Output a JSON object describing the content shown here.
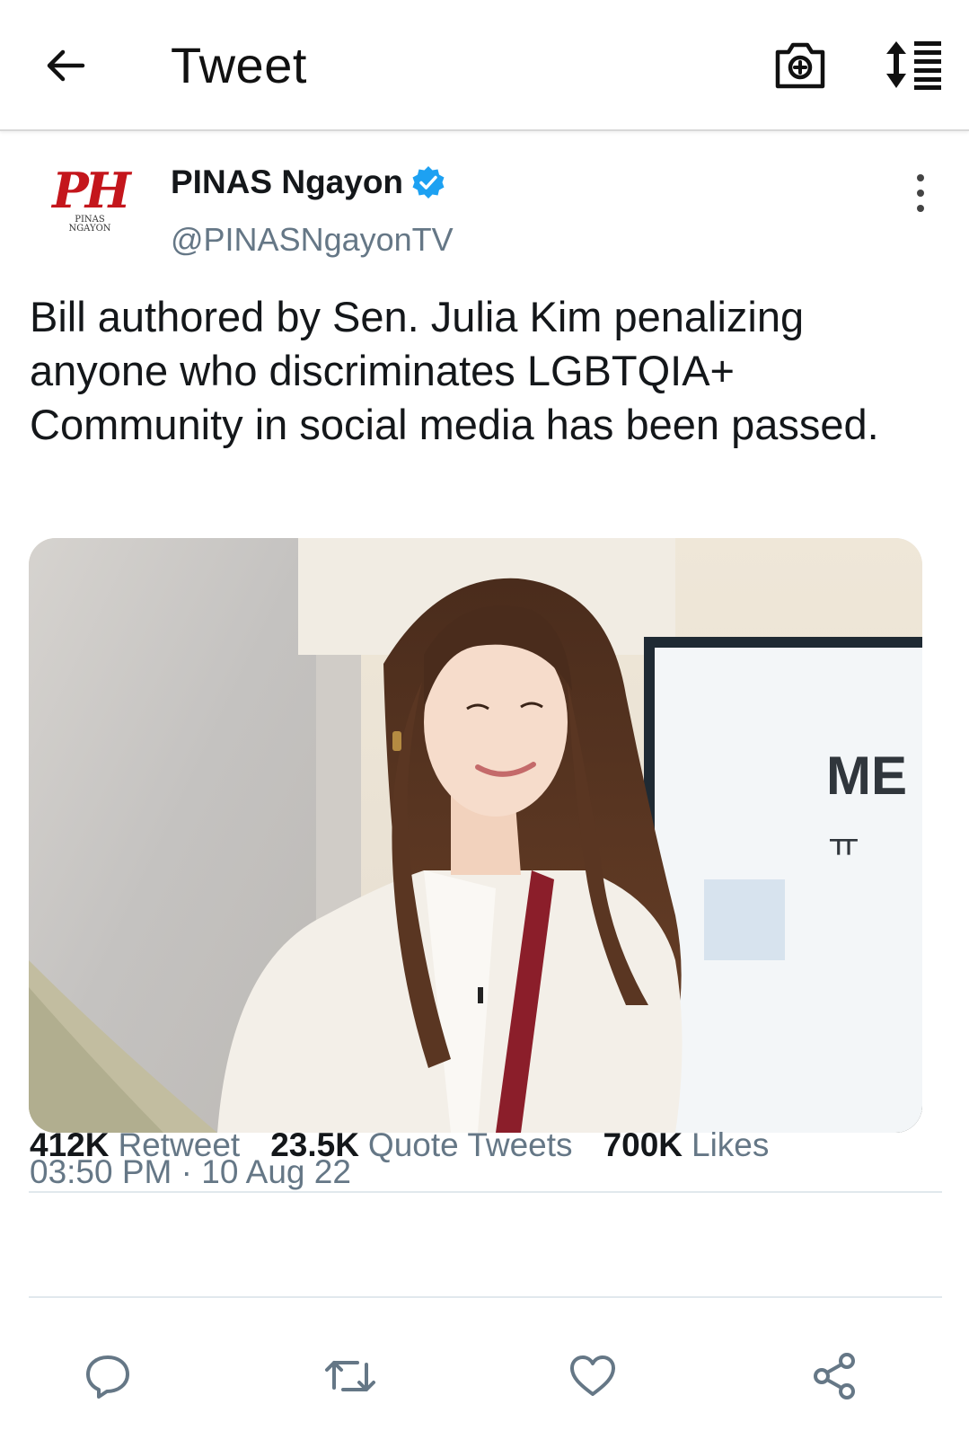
{
  "header": {
    "title": "Tweet",
    "back_icon": "arrow-left-icon",
    "camera_icon": "camera-plus-icon",
    "sort_icon": "sort-list-icon"
  },
  "tweet": {
    "display_name": "PINAS Ngayon",
    "verified": true,
    "handle": "@PINASNgayonTV",
    "avatar": {
      "mark": "PH",
      "sub_line1": "PINAS",
      "sub_line2": "NGAYON"
    },
    "text": "Bill authored by Sen. Julia Kim penalizing anyone who discriminates LGBTQIA+ Community in social media has been passed.",
    "media": {
      "screen_text_line1": "ME",
      "screen_text_line2": "ㅠ"
    },
    "timestamp": "03:50 PM · 10 Aug 22",
    "stats": {
      "retweets_count": "412K",
      "retweets_label": "Retweet",
      "quotes_count": "23.5K",
      "quotes_label": "Quote Tweets",
      "likes_count": "700K",
      "likes_label": "Likes"
    }
  },
  "actions": {
    "reply_icon": "reply-bubble-icon",
    "retweet_icon": "retweet-icon",
    "like_icon": "heart-icon",
    "share_icon": "share-icon"
  },
  "colors": {
    "verified_blue": "#1da1f2",
    "secondary_text": "#657786",
    "avatar_red": "#c4161c"
  }
}
